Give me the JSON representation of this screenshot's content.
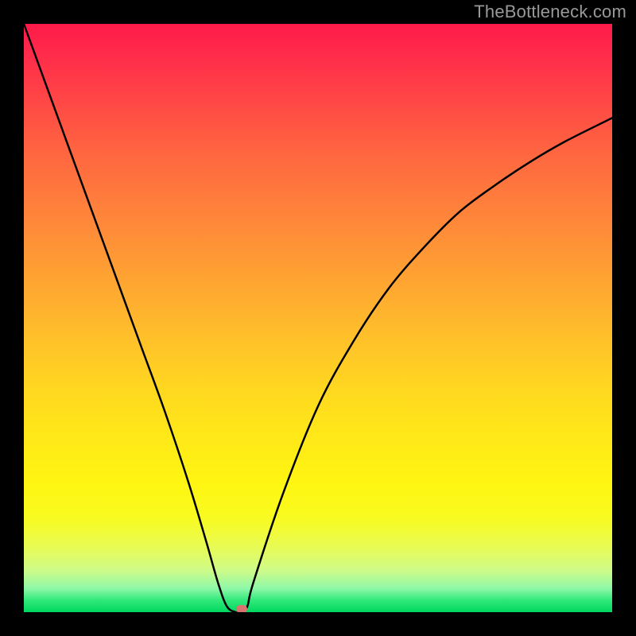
{
  "watermark": "TheBottleneck.com",
  "chart_data": {
    "type": "line",
    "title": "",
    "xlabel": "",
    "ylabel": "",
    "xlim": [
      0,
      100
    ],
    "ylim": [
      0,
      100
    ],
    "grid": false,
    "legend": false,
    "background_gradient": {
      "top": "#ff1a4a",
      "middle": "#ffd720",
      "bottom": "#00d860"
    },
    "series": [
      {
        "name": "bottleneck-curve",
        "color": "#000000",
        "x": [
          0,
          4,
          8,
          12,
          16,
          20,
          24,
          28,
          31,
          33,
          34.5,
          36,
          37,
          38,
          39,
          44,
          50,
          56,
          62,
          68,
          74,
          80,
          86,
          92,
          100
        ],
        "values": [
          100,
          89,
          78,
          67,
          56,
          45,
          34,
          22,
          12,
          5,
          1,
          0,
          0,
          1,
          5,
          20,
          35,
          46,
          55,
          62,
          68,
          72.5,
          76.5,
          80,
          84
        ]
      }
    ],
    "marker": {
      "name": "current-point",
      "color": "#d8736f",
      "x": 37,
      "y": 0.5
    }
  }
}
